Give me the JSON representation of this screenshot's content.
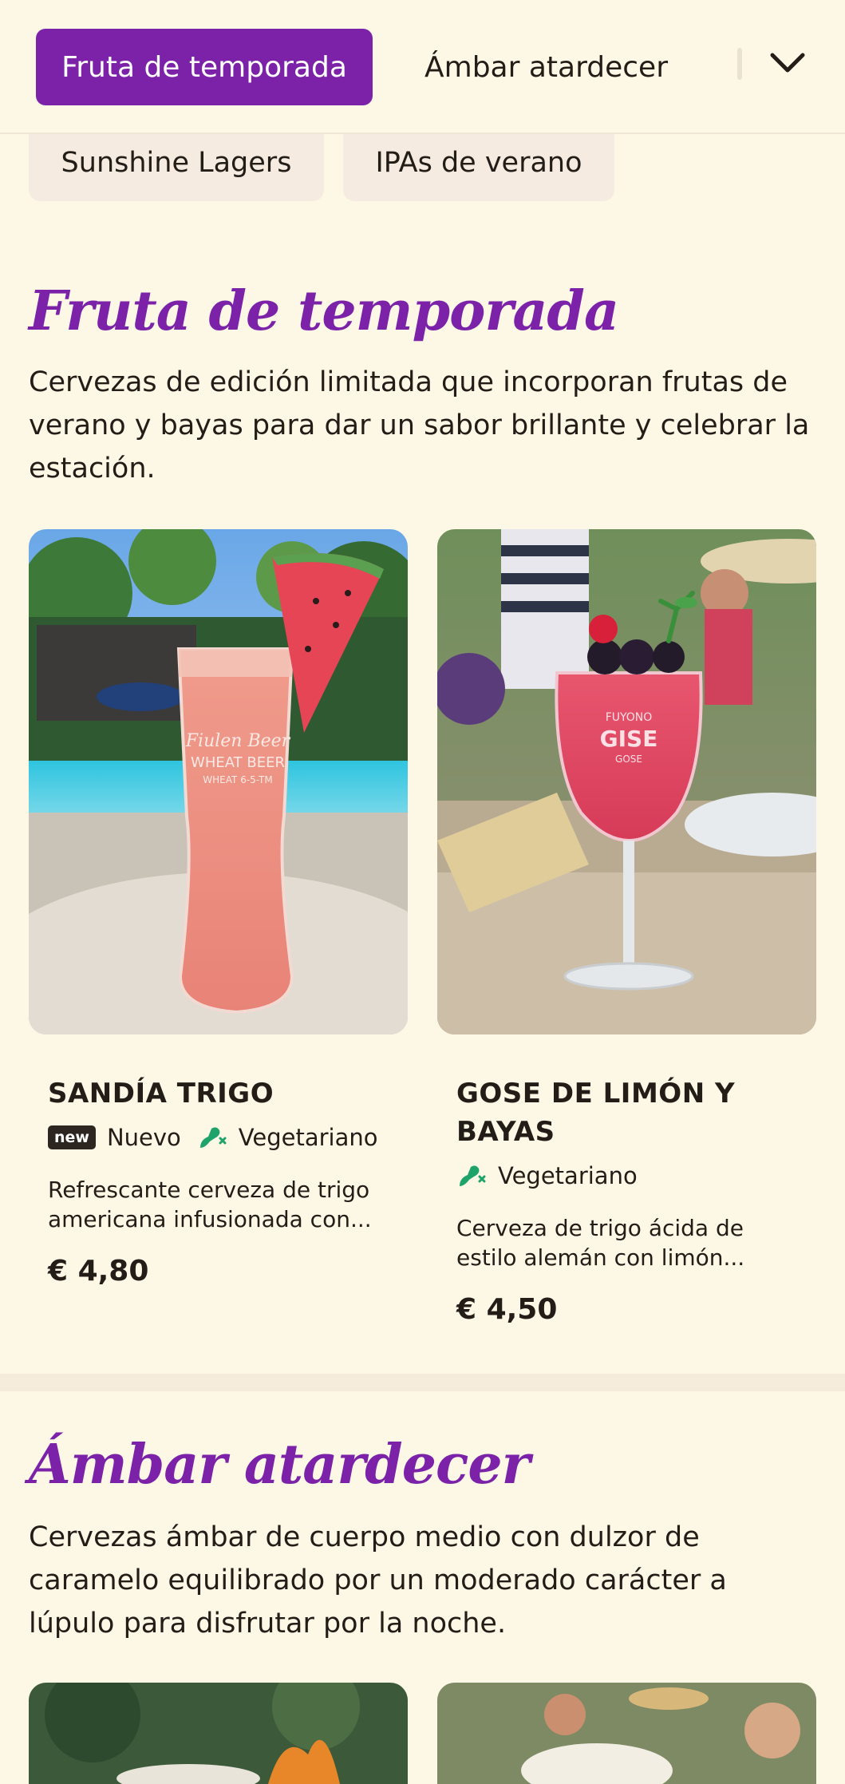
{
  "topbar": {
    "tabs": [
      {
        "label": "Fruta de temporada",
        "active": true
      },
      {
        "label": "Ámbar atardecer",
        "active": false
      }
    ],
    "chevron_icon": "chevron-down-icon"
  },
  "chips": [
    "Sunshine Lagers",
    "IPAs de verano"
  ],
  "sections": [
    {
      "title": "Fruta de temporada",
      "description": "Cervezas de edición limitada que incorporan frutas de verano y bayas para dar un sabor brillante y celebrar la estación.",
      "items": [
        {
          "name": "SANDÍA TRIGO",
          "badges": {
            "new_badge": "new",
            "new_label": "Nuevo",
            "veg_label": "Vegetariano"
          },
          "description": "Refrescante cerveza de trigo americana infusionada con...",
          "price": "€ 4,80",
          "glass_text": [
            "Fiulen Beer",
            "WHEAT BEER",
            "WHEAT 6-5-TM"
          ]
        },
        {
          "name": "GOSE DE LIMÓN Y BAYAS",
          "badges": {
            "veg_label": "Vegetariano"
          },
          "description": "Cerveza de trigo ácida de estilo alemán con limón...",
          "price": "€ 4,50",
          "glass_text": [
            "FUYONO",
            "GISE",
            "GOSE"
          ]
        }
      ]
    },
    {
      "title": "Ámbar atardecer",
      "description": "Cervezas ámbar de cuerpo medio con dulzor de caramelo equilibrado por un moderado carácter a lúpulo para disfrutar por la noche."
    }
  ],
  "colors": {
    "accent": "#7b22a8",
    "background": "#fdf8e6",
    "chip": "#f5ebe0",
    "veg_green": "#1ea36a"
  }
}
